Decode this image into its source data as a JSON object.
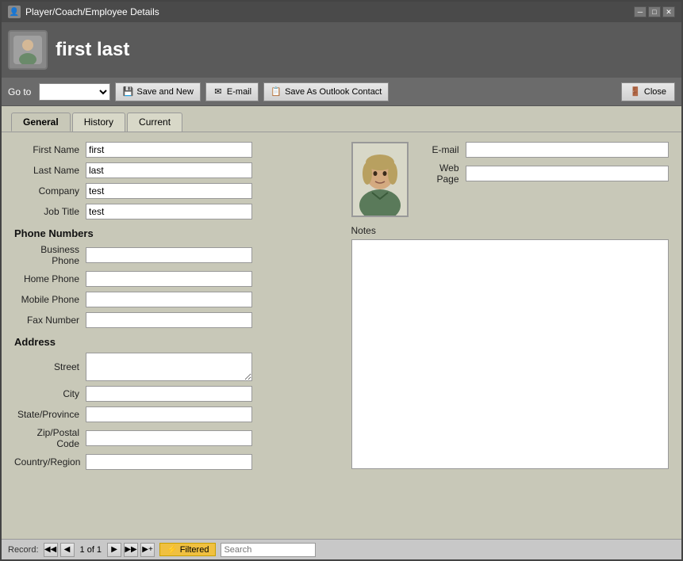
{
  "window": {
    "title": "Player/Coach/Employee Details"
  },
  "header": {
    "title": "first last"
  },
  "toolbar": {
    "goto_label": "Go to",
    "goto_options": [
      ""
    ],
    "save_new_label": "Save and New",
    "email_label": "E-mail",
    "save_outlook_label": "Save As Outlook Contact",
    "close_label": "Close"
  },
  "tabs": [
    {
      "id": "general",
      "label": "General",
      "active": true
    },
    {
      "id": "history",
      "label": "History",
      "active": false
    },
    {
      "id": "current",
      "label": "Current",
      "active": false
    }
  ],
  "form": {
    "first_name_label": "First Name",
    "first_name_value": "first",
    "last_name_label": "Last Name",
    "last_name_value": "last",
    "company_label": "Company",
    "company_value": "test",
    "job_title_label": "Job Title",
    "job_title_value": "test",
    "phone_section_label": "Phone Numbers",
    "business_phone_label": "Business Phone",
    "business_phone_value": "",
    "home_phone_label": "Home Phone",
    "home_phone_value": "",
    "mobile_phone_label": "Mobile Phone",
    "mobile_phone_value": "",
    "fax_number_label": "Fax Number",
    "fax_number_value": "",
    "address_section_label": "Address",
    "street_label": "Street",
    "street_value": "",
    "city_label": "City",
    "city_value": "",
    "state_province_label": "State/Province",
    "state_province_value": "",
    "zip_postal_label": "Zip/Postal Code",
    "zip_postal_value": "",
    "country_region_label": "Country/Region",
    "country_region_value": "",
    "email_label": "E-mail",
    "email_value": "",
    "web_page_label": "Web Page",
    "web_page_value": "",
    "notes_label": "Notes",
    "notes_value": ""
  },
  "statusbar": {
    "record_label": "Record:",
    "record_current": "1 of 1",
    "filtered_label": "Filtered",
    "search_label": "Search",
    "search_placeholder": ""
  },
  "icons": {
    "save_new": "💾",
    "email": "✉",
    "outlook": "📋",
    "close": "✖",
    "filter": "⚡",
    "nav_first": "◀◀",
    "nav_prev": "◀",
    "nav_next": "▶",
    "nav_last": "▶▶",
    "nav_new": "▶+"
  }
}
